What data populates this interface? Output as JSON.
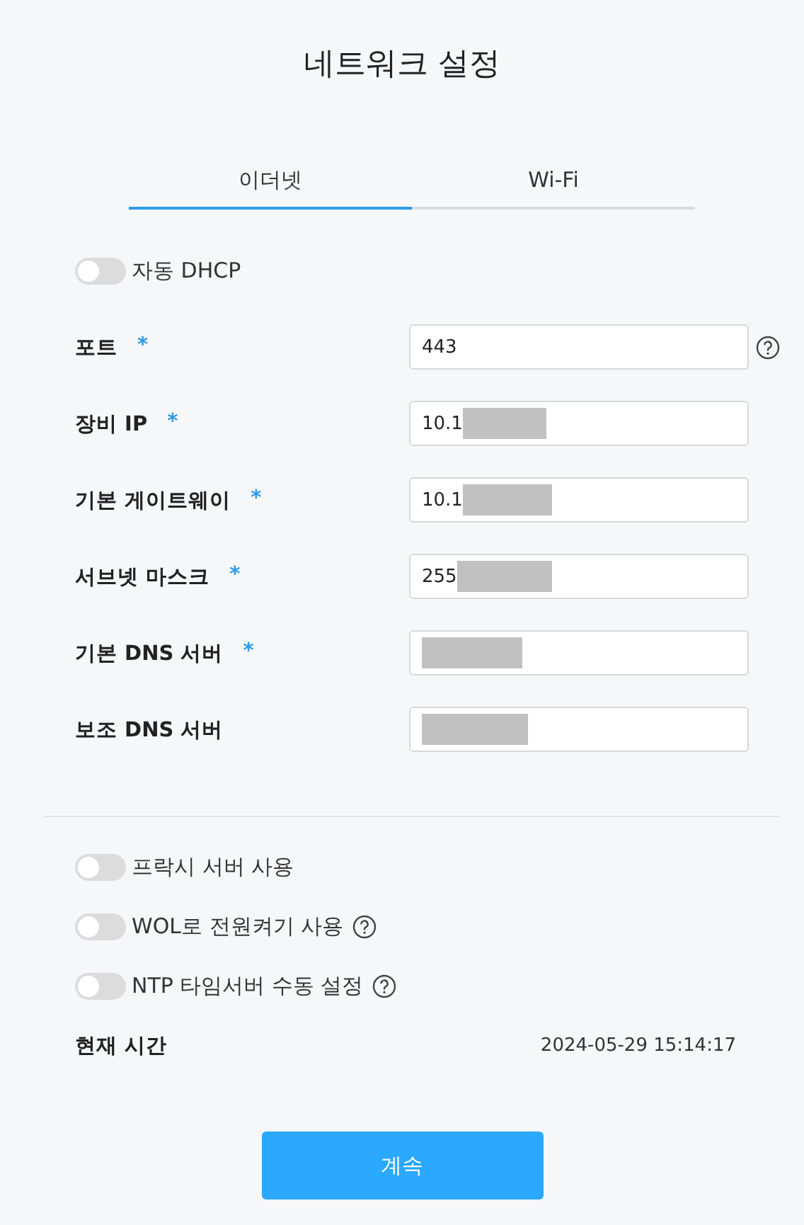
{
  "title": "네트워크 설정",
  "tabs": [
    {
      "label": "이더넷",
      "selected": true
    },
    {
      "label": "Wi-Fi",
      "selected": false
    }
  ],
  "dhcp_toggle": {
    "label": "자동 DHCP",
    "on": false,
    "help": false
  },
  "fields": [
    {
      "label": "포트",
      "required": "*",
      "value": "443",
      "redacted": false,
      "help": true
    },
    {
      "label": "장비 IP",
      "required": "*",
      "value": "10.1",
      "redacted": true,
      "help": false
    },
    {
      "label": "기본 게이트웨이",
      "required": "*",
      "value": "10.1",
      "redacted": true,
      "help": false
    },
    {
      "label": "서브넷 마스크",
      "required": "*",
      "value": "255",
      "redacted": true,
      "help": false
    },
    {
      "label": "기본 DNS 서버",
      "required": "*",
      "redacted": true,
      "help": false
    },
    {
      "label": "보조 DNS 서버",
      "redacted": true,
      "help": false
    }
  ],
  "toggles": [
    {
      "label": "프락시 서버 사용",
      "on": false,
      "help": false
    },
    {
      "label": "WOL로 전원켜기 사용",
      "on": false,
      "help": true
    },
    {
      "label": "NTP 타임서버 수동 설정",
      "on": false,
      "help": true
    }
  ],
  "current_time": {
    "label": "현재 시간",
    "value": "2024-05-29 15:14:17"
  },
  "continue_button": "계속"
}
